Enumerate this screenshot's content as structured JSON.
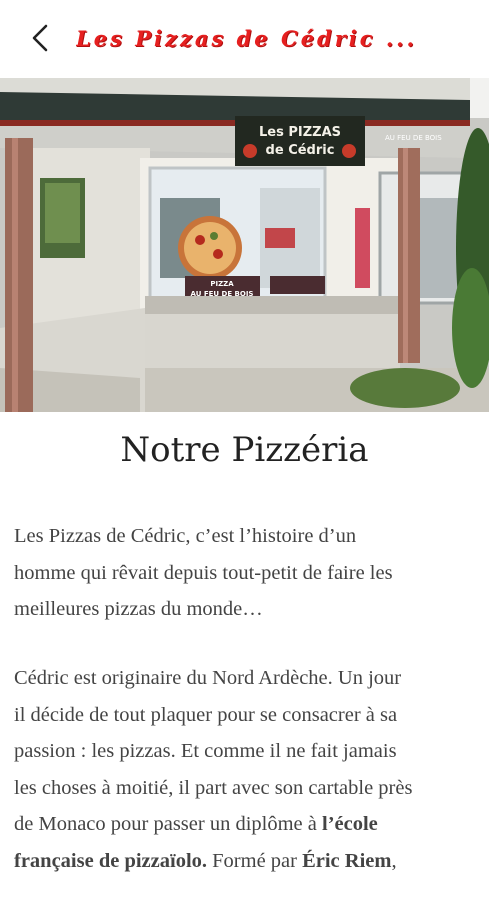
{
  "header": {
    "title": "Les Pizzas de Cédric ...",
    "back_icon": "chevron-left-icon"
  },
  "hero": {
    "sign_line1": "Les PIZZAS",
    "sign_line2": "de Cédric",
    "sign_side": "AU FEU DE BOIS",
    "window_banner_1": "PIZZA",
    "window_banner_2": "AU FEU DE BOIS"
  },
  "page": {
    "title": "Notre Pizzéria"
  },
  "paragraphs": {
    "p1_lines": [
      "Les Pizzas de Cédric, c’est l’histoire d’un",
      "homme qui rêvait depuis tout-petit de faire les",
      "meilleures pizzas du monde…"
    ],
    "p2_line1": "Cédric est originaire du Nord Ardèche. Un jour",
    "p2_line2": "il décide de tout plaquer pour se consacrer à sa",
    "p2_line3": "passion : les pizzas. Et comme il ne fait jamais",
    "p2_line4": "les choses à moitié, il part avec son cartable près",
    "p2_line5_a": "de Monaco pour passer un diplôme à ",
    "p2_line5_b": "l’école",
    "p2_line6_a": "française de pizzaïolo.",
    "p2_line6_b": " Formé par ",
    "p2_line6_c": "Éric Riem",
    "p2_line6_d": ","
  }
}
